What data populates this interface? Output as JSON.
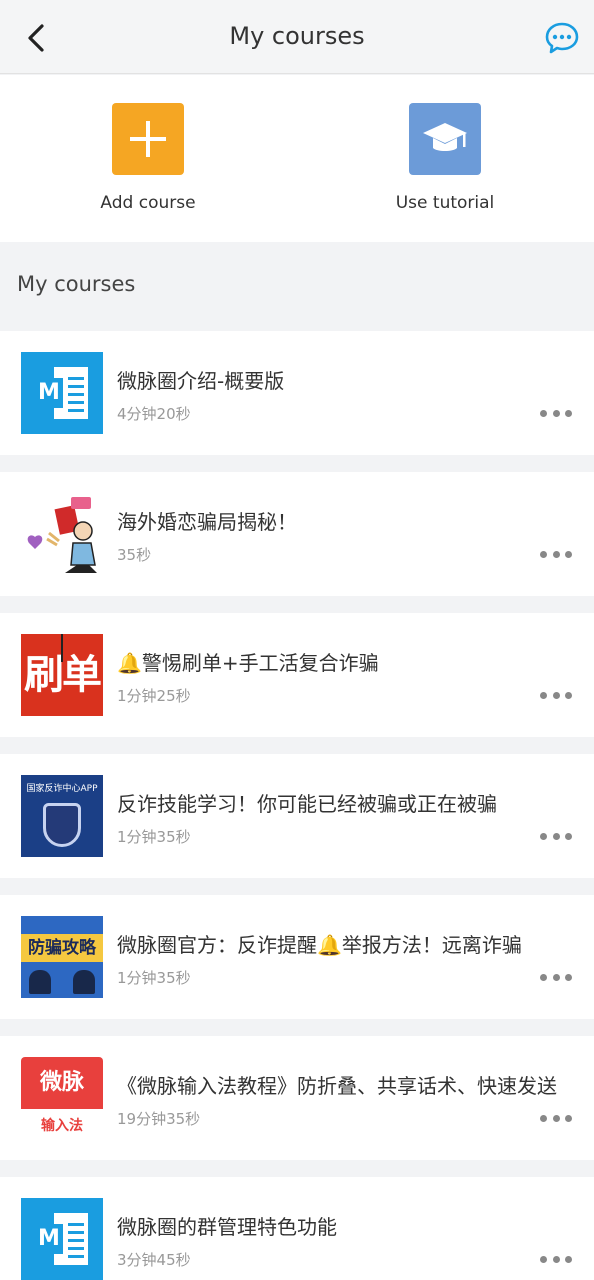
{
  "header": {
    "title": "My courses",
    "back_icon": "chevron-left-icon",
    "chat_icon": "chat-bubble-icon",
    "accent": "#1a9de0"
  },
  "actions": [
    {
      "label": "Add course",
      "icon": "plus-icon",
      "color": "#f5a623"
    },
    {
      "label": "Use tutorial",
      "icon": "graduation-cap-icon",
      "color": "#6c9bd8"
    }
  ],
  "section": {
    "title": "My courses"
  },
  "courses": [
    {
      "title": "微脉圈介绍-概要版",
      "duration": "4分钟20秒",
      "thumb_type": "word-doc"
    },
    {
      "title": "海外婚恋骗局揭秘！",
      "duration": "35秒",
      "thumb_type": "cartoon"
    },
    {
      "title": "🔔警惕刷单+手工活复合诈骗",
      "duration": "1分钟25秒",
      "thumb_type": "fraud",
      "thumb_text": "刷单"
    },
    {
      "title": "反诈技能学习！你可能已经被骗或正在被骗",
      "duration": "1分钟35秒",
      "thumb_type": "app",
      "thumb_text": "国家反诈中心APP"
    },
    {
      "title": "微脉圈官方：反诈提醒🔔举报方法！远离诈骗",
      "duration": "1分钟35秒",
      "thumb_type": "guide",
      "thumb_text": "防骗攻略"
    },
    {
      "title": "《微脉输入法教程》防折叠、共享话术、快速发送",
      "duration": "19分钟35秒",
      "thumb_type": "ime",
      "thumb_text": "微脉",
      "thumb_sub": "输入法"
    },
    {
      "title": "微脉圈的群管理特色功能",
      "duration": "3分钟45秒",
      "thumb_type": "word-doc"
    }
  ]
}
